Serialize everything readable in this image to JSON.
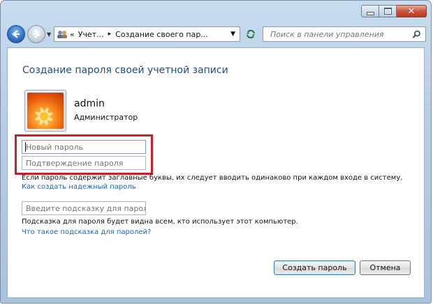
{
  "window": {
    "caption_buttons": {
      "minimize": "minimize-icon",
      "maximize": "maximize-icon",
      "close": "close-icon"
    }
  },
  "nav": {
    "breadcrumb": {
      "overflow": "«",
      "item1": "Учет...",
      "separator": "▸",
      "item2": "Создание своего пар..."
    },
    "search_placeholder": "Поиск в панели управления"
  },
  "page": {
    "title": "Создание пароля своей учетной записи",
    "user": {
      "name": "admin",
      "role": "Администратор"
    },
    "fields": {
      "new_password_placeholder": "Новый пароль",
      "confirm_password_placeholder": "Подтверждение пароля",
      "hint_placeholder": "Введите подсказку для пароля"
    },
    "case_note": "Если пароль содержит заглавные буквы, их следует вводить одинаково при каждом входе в систему.",
    "strong_password_link": "Как создать надежный пароль",
    "hint_note": "Подсказка для пароля будет видна всем, кто использует этот компьютер.",
    "hint_link": "Что такое подсказка для паролей?",
    "buttons": {
      "create": "Создать пароль",
      "cancel": "Отмена"
    }
  },
  "colors": {
    "highlight": "#c8202a",
    "link": "#1a64b6",
    "title": "#1e4e8c"
  }
}
